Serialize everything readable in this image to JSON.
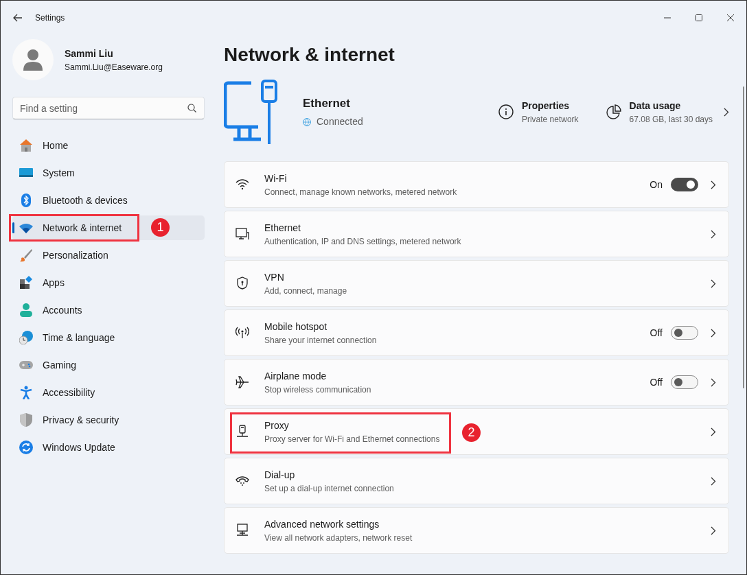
{
  "window": {
    "title": "Settings"
  },
  "profile": {
    "name": "Sammi Liu",
    "email": "Sammi.Liu@Easeware.org"
  },
  "search": {
    "placeholder": "Find a setting"
  },
  "sidebar": {
    "items": [
      {
        "label": "Home",
        "selected": false
      },
      {
        "label": "System",
        "selected": false
      },
      {
        "label": "Bluetooth & devices",
        "selected": false
      },
      {
        "label": "Network & internet",
        "selected": true,
        "annotation": "1"
      },
      {
        "label": "Personalization",
        "selected": false
      },
      {
        "label": "Apps",
        "selected": false
      },
      {
        "label": "Accounts",
        "selected": false
      },
      {
        "label": "Time & language",
        "selected": false
      },
      {
        "label": "Gaming",
        "selected": false
      },
      {
        "label": "Accessibility",
        "selected": false
      },
      {
        "label": "Privacy & security",
        "selected": false
      },
      {
        "label": "Windows Update",
        "selected": false
      }
    ]
  },
  "page_title": "Network & internet",
  "connection": {
    "name": "Ethernet",
    "status": "Connected",
    "properties": {
      "title": "Properties",
      "subtitle": "Private network"
    },
    "data_usage": {
      "title": "Data usage",
      "subtitle": "67.08 GB, last 30 days"
    }
  },
  "settings": [
    {
      "title": "Wi-Fi",
      "subtitle": "Connect, manage known networks, metered network",
      "toggle": {
        "text": "On",
        "on": true
      }
    },
    {
      "title": "Ethernet",
      "subtitle": "Authentication, IP and DNS settings, metered network"
    },
    {
      "title": "VPN",
      "subtitle": "Add, connect, manage"
    },
    {
      "title": "Mobile hotspot",
      "subtitle": "Share your internet connection",
      "toggle": {
        "text": "Off",
        "on": false
      }
    },
    {
      "title": "Airplane mode",
      "subtitle": "Stop wireless communication",
      "toggle": {
        "text": "Off",
        "on": false
      }
    },
    {
      "title": "Proxy",
      "subtitle": "Proxy server for Wi-Fi and Ethernet connections",
      "annotation": "2"
    },
    {
      "title": "Dial-up",
      "subtitle": "Set up a dial-up internet connection"
    },
    {
      "title": "Advanced network settings",
      "subtitle": "View all network adapters, network reset"
    }
  ]
}
